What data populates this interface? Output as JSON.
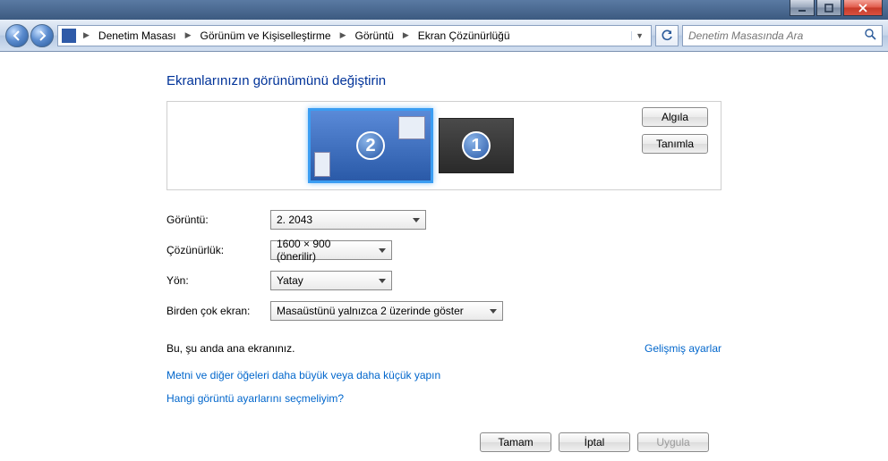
{
  "titlebar": {},
  "nav": {
    "breadcrumbs": [
      "Denetim Masası",
      "Görünüm ve Kişiselleştirme",
      "Görüntü",
      "Ekran Çözünürlüğü"
    ],
    "search_placeholder": "Denetim Masasında Ara"
  },
  "page": {
    "title": "Ekranlarınızın görünümünü değiştirin",
    "detect_label": "Algıla",
    "identify_label": "Tanımla",
    "monitors": [
      {
        "id": "2",
        "primary": true
      },
      {
        "id": "1",
        "primary": false
      }
    ]
  },
  "form": {
    "display_label": "Görüntü:",
    "display_value": "2. 2043",
    "resolution_label": "Çözünürlük:",
    "resolution_value": "1600 × 900 (önerilir)",
    "orientation_label": "Yön:",
    "orientation_value": "Yatay",
    "multi_label": "Birden çok ekran:",
    "multi_value": "Masaüstünü yalnızca 2 üzerinde göster"
  },
  "status": {
    "main_screen_text": "Bu, şu anda ana ekranınız.",
    "advanced_link": "Gelişmiş ayarlar"
  },
  "links": {
    "text_size": "Metni ve diğer öğeleri daha büyük veya daha küçük yapın",
    "which_settings": "Hangi görüntü ayarlarını seçmeliyim?"
  },
  "buttons": {
    "ok": "Tamam",
    "cancel": "İptal",
    "apply": "Uygula"
  }
}
